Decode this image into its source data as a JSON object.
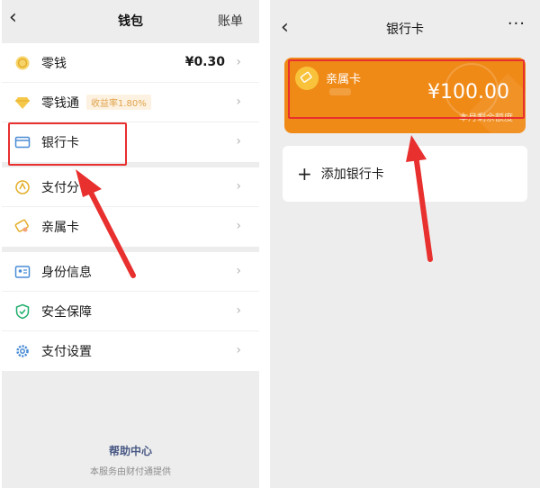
{
  "left": {
    "nav": {
      "back_icon": "chevron-left-icon",
      "title": "钱包",
      "right_action": "账单"
    },
    "groups": [
      {
        "items": [
          {
            "icon": "coin-icon",
            "label": "零钱",
            "value": "¥0.30"
          },
          {
            "icon": "diamond-icon",
            "label": "零钱通",
            "badge": "收益率1.80%"
          },
          {
            "icon": "bank-card-icon",
            "label": "银行卡"
          }
        ]
      },
      {
        "items": [
          {
            "icon": "payment-score-icon",
            "label": "支付分"
          },
          {
            "icon": "family-card-icon",
            "label": "亲属卡"
          }
        ]
      },
      {
        "items": [
          {
            "icon": "id-info-icon",
            "label": "身份信息"
          },
          {
            "icon": "shield-icon",
            "label": "安全保障"
          },
          {
            "icon": "gear-icon",
            "label": "支付设置"
          }
        ]
      }
    ],
    "footer": {
      "link": "帮助中心",
      "note": "本服务由财付通提供"
    }
  },
  "right": {
    "nav": {
      "back_icon": "chevron-left-icon",
      "title": "银行卡",
      "more_icon": "more-dots-icon"
    },
    "card": {
      "name": "亲属卡",
      "amount": "¥100.00",
      "sub": "本月剩余额度"
    },
    "add": {
      "label": "添加银行卡"
    }
  },
  "colors": {
    "card_orange": "#f08a17",
    "highlight_red": "#e8302f",
    "background": "#ededed"
  }
}
